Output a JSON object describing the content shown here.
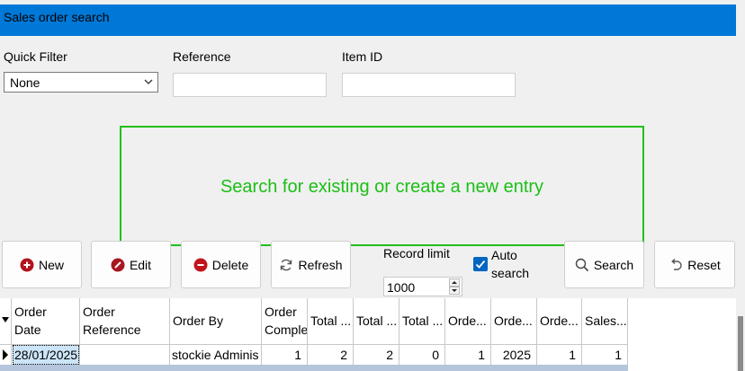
{
  "window": {
    "title": "Sales order search"
  },
  "filters": {
    "quick_filter_label": "Quick Filter",
    "quick_filter_value": "None",
    "reference_label": "Reference",
    "reference_value": "",
    "item_id_label": "Item ID",
    "item_id_value": ""
  },
  "hint": {
    "text": "Search for existing or create a new entry"
  },
  "toolbar": {
    "new_label": "New",
    "edit_label": "Edit",
    "delete_label": "Delete",
    "refresh_label": "Refresh",
    "record_limit_label": "Record limit",
    "record_limit_value": "1000",
    "auto_search_label_1": "Auto",
    "auto_search_label_2": "search",
    "auto_search_checked": true,
    "search_label": "Search",
    "reset_label": "Reset"
  },
  "grid": {
    "headers": [
      [
        "Order",
        "Date"
      ],
      [
        "Order",
        "Reference"
      ],
      [
        "Order By"
      ],
      [
        "Order",
        "Comple"
      ],
      [
        "Total ..."
      ],
      [
        "Total ..."
      ],
      [
        "Total ..."
      ],
      [
        "Orde..."
      ],
      [
        "Orde..."
      ],
      [
        "Orde..."
      ],
      [
        "Sales..."
      ]
    ],
    "rows": [
      [
        "28/01/2025",
        "",
        "stockie Adminis",
        "1",
        "2",
        "2",
        "0",
        "1",
        "2025",
        "1",
        "1"
      ]
    ]
  },
  "colors": {
    "titlebar": "#0078d7",
    "hint_border": "#22c01a",
    "hint_text": "#1bbf15",
    "new_icon": "#b0161e",
    "edit_icon": "#a8171f",
    "delete_icon": "#c0151d",
    "checkbox": "#0067c0"
  },
  "icons": {
    "new": "plus-circle-icon",
    "edit": "pencil-circle-icon",
    "delete": "minus-circle-icon",
    "refresh": "refresh-icon",
    "search": "search-icon",
    "reset": "undo-icon"
  }
}
